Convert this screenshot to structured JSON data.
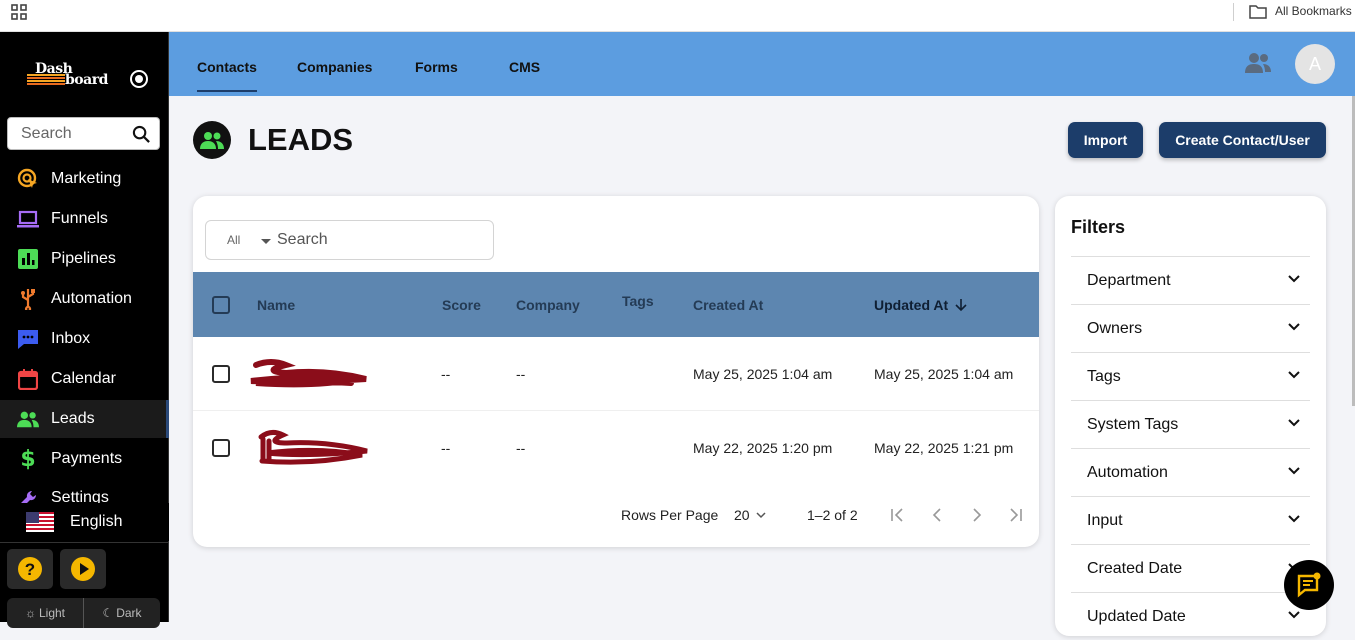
{
  "bookmarks_bar": {
    "label": "All Bookmarks"
  },
  "brand": {
    "line1": "Dash",
    "line2": "board"
  },
  "sidebar": {
    "search_placeholder": "Search",
    "items": [
      {
        "label": "Marketing",
        "icon": "marketing-icon",
        "color": "#f5a623"
      },
      {
        "label": "Funnels",
        "icon": "laptop-icon",
        "color": "#a66cf5"
      },
      {
        "label": "Pipelines",
        "icon": "bar-chart-icon",
        "color": "#4ddc56"
      },
      {
        "label": "Automation",
        "icon": "usb-icon",
        "color": "#f07b2e"
      },
      {
        "label": "Inbox",
        "icon": "chat-icon",
        "color": "#3c5cf0"
      },
      {
        "label": "Calendar",
        "icon": "calendar-icon",
        "color": "#f04545"
      },
      {
        "label": "Leads",
        "icon": "people-icon",
        "color": "#4ddc56"
      },
      {
        "label": "Payments",
        "icon": "dollar-icon",
        "color": "#4ddc56"
      },
      {
        "label": "Settings",
        "icon": "wrench-icon",
        "color": "#a66cf5"
      }
    ],
    "language": "English",
    "theme": {
      "light": "Light",
      "dark": "Dark"
    }
  },
  "topnav": {
    "tabs": [
      "Contacts",
      "Companies",
      "Forms",
      "CMS"
    ],
    "active_tab": "Contacts",
    "avatar_initial": "A"
  },
  "page": {
    "title": "LEADS",
    "import_label": "Import",
    "create_label": "Create Contact/User"
  },
  "table": {
    "filter_scope": "All",
    "search_placeholder": "Search",
    "columns": [
      "Name",
      "Score",
      "Company",
      "Tags",
      "Created At",
      "Updated At"
    ],
    "sorted_column": "Updated At",
    "rows": [
      {
        "name": "[redacted]",
        "score": "--",
        "company": "--",
        "tags": "",
        "created_at": "May 25, 2025 1:04 am",
        "updated_at": "May 25, 2025 1:04 am"
      },
      {
        "name": "[redacted]",
        "score": "--",
        "company": "--",
        "tags": "",
        "created_at": "May 22, 2025 1:20 pm",
        "updated_at": "May 22, 2025 1:21 pm"
      }
    ],
    "pagination": {
      "rows_per_page_label": "Rows Per Page",
      "rows_per_page": "20",
      "range": "1–2 of 2"
    }
  },
  "filters": {
    "title": "Filters",
    "items": [
      "Department",
      "Owners",
      "Tags",
      "System Tags",
      "Automation",
      "Input",
      "Created Date",
      "Updated Date"
    ]
  },
  "colors": {
    "nav_blue": "#5c9de0",
    "primary": "#1c3d6a",
    "header_blue": "#5d86b0",
    "redaction": "#8b0d1a"
  }
}
